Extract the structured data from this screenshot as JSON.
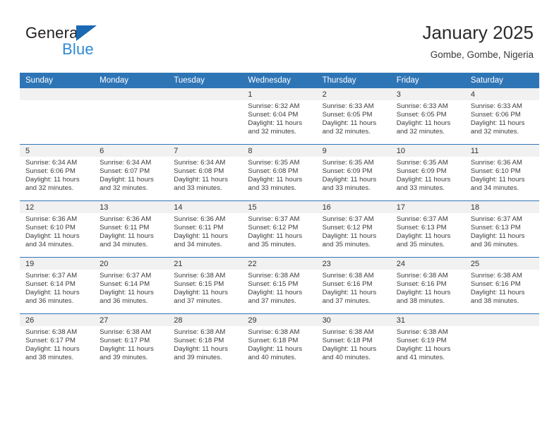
{
  "brand": {
    "name_part1": "General",
    "name_part2": "Blue",
    "triangle_color": "#1b69b2",
    "blue_color": "#2e8ad4"
  },
  "header": {
    "title": "January 2025",
    "subtitle": "Gombe, Gombe, Nigeria"
  },
  "theme": {
    "header_row_bg": "#2e75b6",
    "daynum_band_bg": "#f1f1f1",
    "row_separator": "#2e75b6",
    "text": "#3c3c3c"
  },
  "weekdays": [
    "Sunday",
    "Monday",
    "Tuesday",
    "Wednesday",
    "Thursday",
    "Friday",
    "Saturday"
  ],
  "weeks": [
    [
      {
        "day": "",
        "sunrise": "",
        "sunset": "",
        "daylight_line1": "",
        "daylight_line2": ""
      },
      {
        "day": "",
        "sunrise": "",
        "sunset": "",
        "daylight_line1": "",
        "daylight_line2": ""
      },
      {
        "day": "",
        "sunrise": "",
        "sunset": "",
        "daylight_line1": "",
        "daylight_line2": ""
      },
      {
        "day": "1",
        "sunrise": "Sunrise: 6:32 AM",
        "sunset": "Sunset: 6:04 PM",
        "daylight_line1": "Daylight: 11 hours",
        "daylight_line2": "and 32 minutes."
      },
      {
        "day": "2",
        "sunrise": "Sunrise: 6:33 AM",
        "sunset": "Sunset: 6:05 PM",
        "daylight_line1": "Daylight: 11 hours",
        "daylight_line2": "and 32 minutes."
      },
      {
        "day": "3",
        "sunrise": "Sunrise: 6:33 AM",
        "sunset": "Sunset: 6:05 PM",
        "daylight_line1": "Daylight: 11 hours",
        "daylight_line2": "and 32 minutes."
      },
      {
        "day": "4",
        "sunrise": "Sunrise: 6:33 AM",
        "sunset": "Sunset: 6:06 PM",
        "daylight_line1": "Daylight: 11 hours",
        "daylight_line2": "and 32 minutes."
      }
    ],
    [
      {
        "day": "5",
        "sunrise": "Sunrise: 6:34 AM",
        "sunset": "Sunset: 6:06 PM",
        "daylight_line1": "Daylight: 11 hours",
        "daylight_line2": "and 32 minutes."
      },
      {
        "day": "6",
        "sunrise": "Sunrise: 6:34 AM",
        "sunset": "Sunset: 6:07 PM",
        "daylight_line1": "Daylight: 11 hours",
        "daylight_line2": "and 32 minutes."
      },
      {
        "day": "7",
        "sunrise": "Sunrise: 6:34 AM",
        "sunset": "Sunset: 6:08 PM",
        "daylight_line1": "Daylight: 11 hours",
        "daylight_line2": "and 33 minutes."
      },
      {
        "day": "8",
        "sunrise": "Sunrise: 6:35 AM",
        "sunset": "Sunset: 6:08 PM",
        "daylight_line1": "Daylight: 11 hours",
        "daylight_line2": "and 33 minutes."
      },
      {
        "day": "9",
        "sunrise": "Sunrise: 6:35 AM",
        "sunset": "Sunset: 6:09 PM",
        "daylight_line1": "Daylight: 11 hours",
        "daylight_line2": "and 33 minutes."
      },
      {
        "day": "10",
        "sunrise": "Sunrise: 6:35 AM",
        "sunset": "Sunset: 6:09 PM",
        "daylight_line1": "Daylight: 11 hours",
        "daylight_line2": "and 33 minutes."
      },
      {
        "day": "11",
        "sunrise": "Sunrise: 6:36 AM",
        "sunset": "Sunset: 6:10 PM",
        "daylight_line1": "Daylight: 11 hours",
        "daylight_line2": "and 34 minutes."
      }
    ],
    [
      {
        "day": "12",
        "sunrise": "Sunrise: 6:36 AM",
        "sunset": "Sunset: 6:10 PM",
        "daylight_line1": "Daylight: 11 hours",
        "daylight_line2": "and 34 minutes."
      },
      {
        "day": "13",
        "sunrise": "Sunrise: 6:36 AM",
        "sunset": "Sunset: 6:11 PM",
        "daylight_line1": "Daylight: 11 hours",
        "daylight_line2": "and 34 minutes."
      },
      {
        "day": "14",
        "sunrise": "Sunrise: 6:36 AM",
        "sunset": "Sunset: 6:11 PM",
        "daylight_line1": "Daylight: 11 hours",
        "daylight_line2": "and 34 minutes."
      },
      {
        "day": "15",
        "sunrise": "Sunrise: 6:37 AM",
        "sunset": "Sunset: 6:12 PM",
        "daylight_line1": "Daylight: 11 hours",
        "daylight_line2": "and 35 minutes."
      },
      {
        "day": "16",
        "sunrise": "Sunrise: 6:37 AM",
        "sunset": "Sunset: 6:12 PM",
        "daylight_line1": "Daylight: 11 hours",
        "daylight_line2": "and 35 minutes."
      },
      {
        "day": "17",
        "sunrise": "Sunrise: 6:37 AM",
        "sunset": "Sunset: 6:13 PM",
        "daylight_line1": "Daylight: 11 hours",
        "daylight_line2": "and 35 minutes."
      },
      {
        "day": "18",
        "sunrise": "Sunrise: 6:37 AM",
        "sunset": "Sunset: 6:13 PM",
        "daylight_line1": "Daylight: 11 hours",
        "daylight_line2": "and 36 minutes."
      }
    ],
    [
      {
        "day": "19",
        "sunrise": "Sunrise: 6:37 AM",
        "sunset": "Sunset: 6:14 PM",
        "daylight_line1": "Daylight: 11 hours",
        "daylight_line2": "and 36 minutes."
      },
      {
        "day": "20",
        "sunrise": "Sunrise: 6:37 AM",
        "sunset": "Sunset: 6:14 PM",
        "daylight_line1": "Daylight: 11 hours",
        "daylight_line2": "and 36 minutes."
      },
      {
        "day": "21",
        "sunrise": "Sunrise: 6:38 AM",
        "sunset": "Sunset: 6:15 PM",
        "daylight_line1": "Daylight: 11 hours",
        "daylight_line2": "and 37 minutes."
      },
      {
        "day": "22",
        "sunrise": "Sunrise: 6:38 AM",
        "sunset": "Sunset: 6:15 PM",
        "daylight_line1": "Daylight: 11 hours",
        "daylight_line2": "and 37 minutes."
      },
      {
        "day": "23",
        "sunrise": "Sunrise: 6:38 AM",
        "sunset": "Sunset: 6:16 PM",
        "daylight_line1": "Daylight: 11 hours",
        "daylight_line2": "and 37 minutes."
      },
      {
        "day": "24",
        "sunrise": "Sunrise: 6:38 AM",
        "sunset": "Sunset: 6:16 PM",
        "daylight_line1": "Daylight: 11 hours",
        "daylight_line2": "and 38 minutes."
      },
      {
        "day": "25",
        "sunrise": "Sunrise: 6:38 AM",
        "sunset": "Sunset: 6:16 PM",
        "daylight_line1": "Daylight: 11 hours",
        "daylight_line2": "and 38 minutes."
      }
    ],
    [
      {
        "day": "26",
        "sunrise": "Sunrise: 6:38 AM",
        "sunset": "Sunset: 6:17 PM",
        "daylight_line1": "Daylight: 11 hours",
        "daylight_line2": "and 38 minutes."
      },
      {
        "day": "27",
        "sunrise": "Sunrise: 6:38 AM",
        "sunset": "Sunset: 6:17 PM",
        "daylight_line1": "Daylight: 11 hours",
        "daylight_line2": "and 39 minutes."
      },
      {
        "day": "28",
        "sunrise": "Sunrise: 6:38 AM",
        "sunset": "Sunset: 6:18 PM",
        "daylight_line1": "Daylight: 11 hours",
        "daylight_line2": "and 39 minutes."
      },
      {
        "day": "29",
        "sunrise": "Sunrise: 6:38 AM",
        "sunset": "Sunset: 6:18 PM",
        "daylight_line1": "Daylight: 11 hours",
        "daylight_line2": "and 40 minutes."
      },
      {
        "day": "30",
        "sunrise": "Sunrise: 6:38 AM",
        "sunset": "Sunset: 6:18 PM",
        "daylight_line1": "Daylight: 11 hours",
        "daylight_line2": "and 40 minutes."
      },
      {
        "day": "31",
        "sunrise": "Sunrise: 6:38 AM",
        "sunset": "Sunset: 6:19 PM",
        "daylight_line1": "Daylight: 11 hours",
        "daylight_line2": "and 41 minutes."
      },
      {
        "day": "",
        "sunrise": "",
        "sunset": "",
        "daylight_line1": "",
        "daylight_line2": ""
      }
    ]
  ]
}
